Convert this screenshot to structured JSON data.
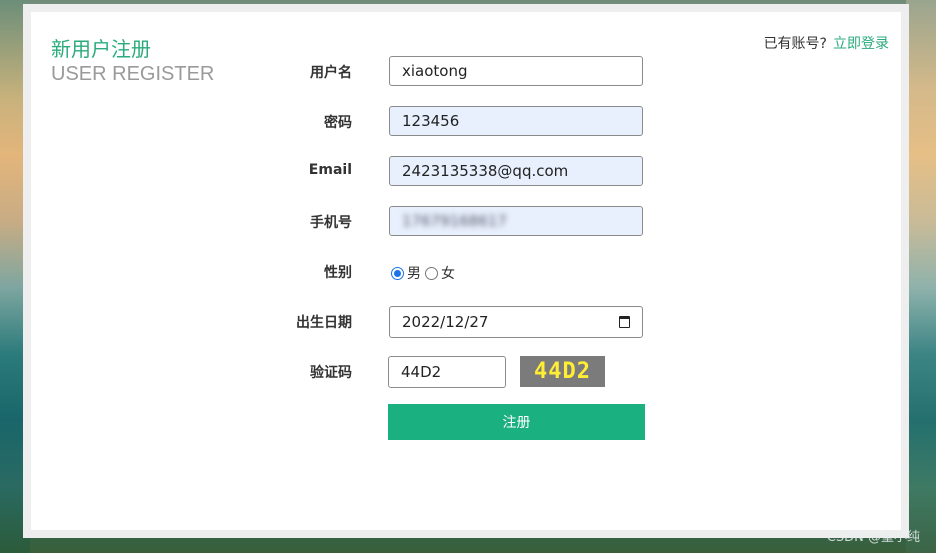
{
  "header": {
    "title_cn": "新用户注册",
    "title_en": "USER REGISTER",
    "login_prompt": "已有账号?",
    "login_link": "立即登录"
  },
  "form": {
    "username": {
      "label": "用户名",
      "value": "xiaotong"
    },
    "password": {
      "label": "密码",
      "value": "123456"
    },
    "email": {
      "label": "Email",
      "value": "2423135338@qq.com"
    },
    "phone": {
      "label": "手机号",
      "value": "17679168617"
    },
    "gender": {
      "label": "性别",
      "options": [
        "男",
        "女"
      ],
      "selected": "男"
    },
    "birthday": {
      "label": "出生日期",
      "value": "2022/12/27"
    },
    "captcha": {
      "label": "验证码",
      "value": "44D2",
      "image_text": "44D2"
    },
    "submit_label": "注册"
  },
  "colors": {
    "accent": "#2bab7d",
    "button": "#1ab080",
    "captcha_bg": "#7b7b7b",
    "captcha_text": "#ffee33"
  },
  "watermark": "CSDN @童小纯"
}
